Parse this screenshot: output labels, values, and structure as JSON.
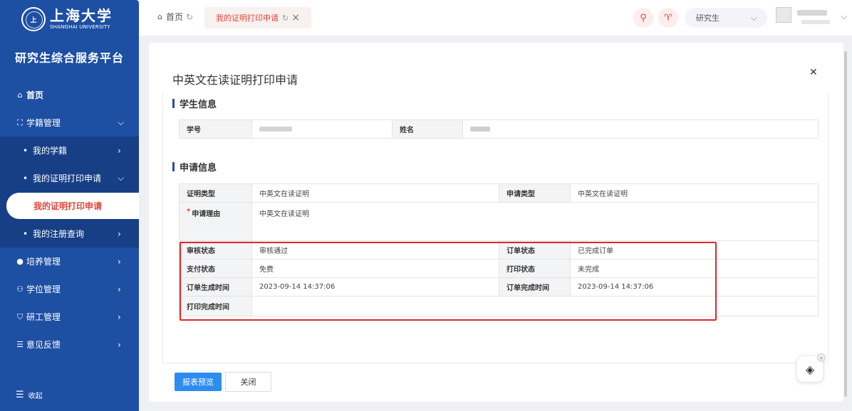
{
  "university": {
    "name_cn": "上海大学",
    "name_en": "SHANGHAI UNIVERSITY"
  },
  "platform_title": "研究生综合服务平台",
  "sidebar": {
    "items": [
      {
        "label": "首页",
        "icon": "home-icon"
      },
      {
        "label": "学籍管理",
        "icon": "scan-icon"
      },
      {
        "label": "我的学籍"
      },
      {
        "label": "我的证明打印申请"
      },
      {
        "label": "我的证明打印申请"
      },
      {
        "label": "我的注册查询"
      },
      {
        "label": "培养管理",
        "icon": "user-icon"
      },
      {
        "label": "学位管理",
        "icon": "user-group-icon"
      },
      {
        "label": "研工管理",
        "icon": "shield-icon"
      },
      {
        "label": "意见反馈",
        "icon": "feedback-icon"
      }
    ],
    "collapse_label": "收起"
  },
  "tabs": {
    "home": "首页",
    "active": "我的证明打印申请"
  },
  "header": {
    "role": "研究生"
  },
  "dialog": {
    "title": "中英文在读证明打印申请",
    "student_section": "学生信息",
    "apply_section": "申请信息",
    "student": {
      "id_label": "学号",
      "name_label": "姓名"
    },
    "fields": {
      "cert_type_label": "证明类型",
      "cert_type": "中英文在读证明",
      "apply_type_label": "申请类型",
      "apply_type": "中英文在读证明",
      "reason_label": "申请理由",
      "reason": "中英文在读证明",
      "audit_label": "审核状态",
      "audit": "审核通过",
      "order_status_label": "订单状态",
      "order_status": "已完成订单",
      "pay_label": "支付状态",
      "pay": "免费",
      "print_status_label": "打印状态",
      "print_status": "未完成",
      "order_create_label": "订单生成时间",
      "order_create": "2023-09-14 14:37:06",
      "order_done_label": "订单完成时间",
      "order_done": "2023-09-14 14:37:06",
      "print_done_label": "打印完成时间",
      "print_done": ""
    },
    "buttons": {
      "preview": "报表预览",
      "close": "关闭"
    }
  },
  "colors": {
    "sidebar": "#1d4fa3",
    "accent": "#e0463a",
    "primary_button": "#2d8cf0",
    "highlight": "#e0262c"
  }
}
